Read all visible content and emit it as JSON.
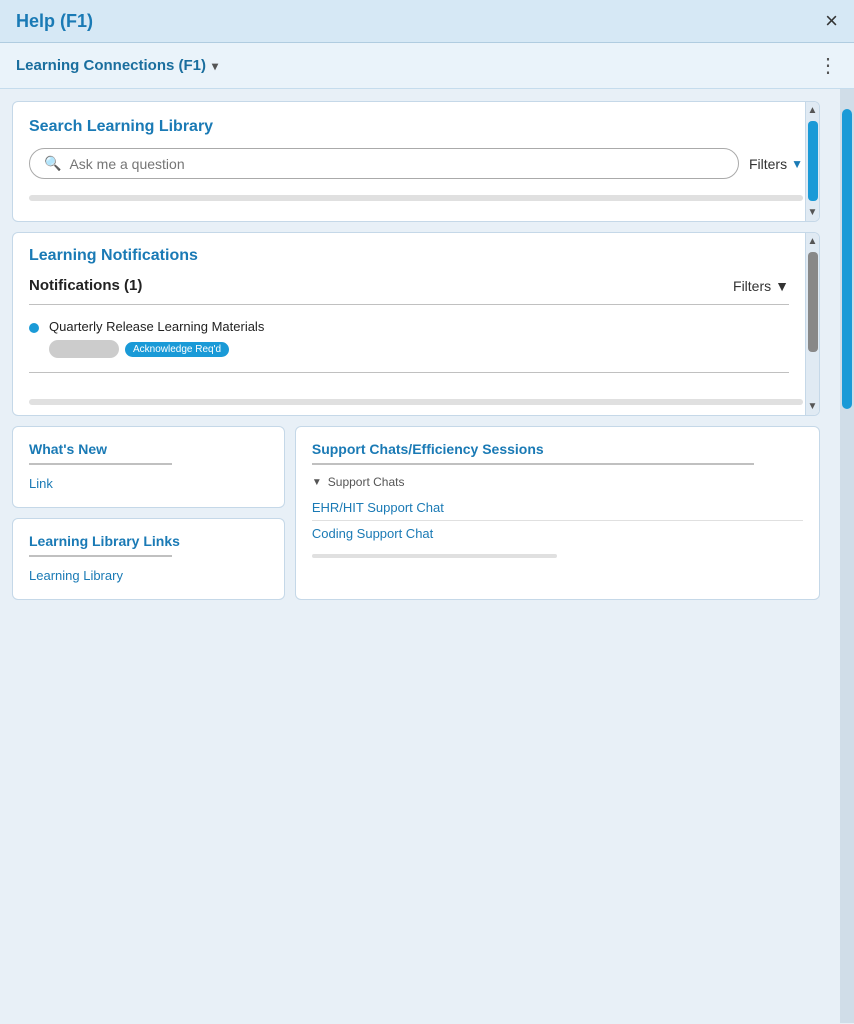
{
  "header": {
    "title": "Help (F1)",
    "close_label": "×"
  },
  "subheader": {
    "title": "Learning Connections (F1)",
    "chevron": "▾",
    "menu_dots": "⋮"
  },
  "search_panel": {
    "title": "Search Learning Library",
    "input_placeholder": "Ask me a question",
    "filters_label": "Filters"
  },
  "notifications_panel": {
    "title": "Learning Notifications",
    "notifications_header": "Notifications (1)",
    "filters_label": "Filters",
    "items": [
      {
        "title": "Quarterly Release Learning Materials",
        "tag_blue": "Acknowledge Req'd"
      }
    ]
  },
  "whats_new": {
    "title": "What's New",
    "link_label": "Link"
  },
  "library_links": {
    "title": "Learning Library Links",
    "link_label": "Learning Library"
  },
  "support_chats": {
    "title": "Support Chats/Efficiency Sessions",
    "section_label": "Support Chats",
    "links": [
      "EHR/HIT Support Chat",
      "Coding Support Chat"
    ]
  }
}
